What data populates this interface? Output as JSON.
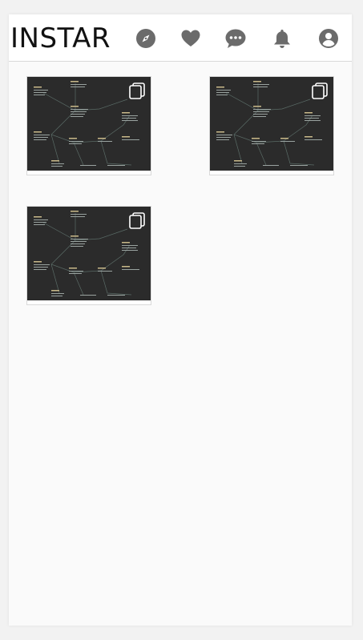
{
  "app": {
    "logo_text": "INSTAR"
  },
  "nav": {
    "icons": [
      "compass-icon",
      "heart-icon",
      "chat-bubble-icon",
      "bell-icon",
      "profile-icon"
    ]
  },
  "feed": {
    "posts": [
      {
        "thumbnail": "diagram-thumbnail",
        "badge": "multiple-images-icon"
      },
      {
        "thumbnail": "diagram-thumbnail",
        "badge": "multiple-images-icon"
      },
      {
        "thumbnail": "diagram-thumbnail",
        "badge": "multiple-images-icon"
      }
    ]
  },
  "colors": {
    "icon": "#6b6b6b",
    "thumb_bg": "#2b2b2b",
    "logo": "#111111"
  }
}
